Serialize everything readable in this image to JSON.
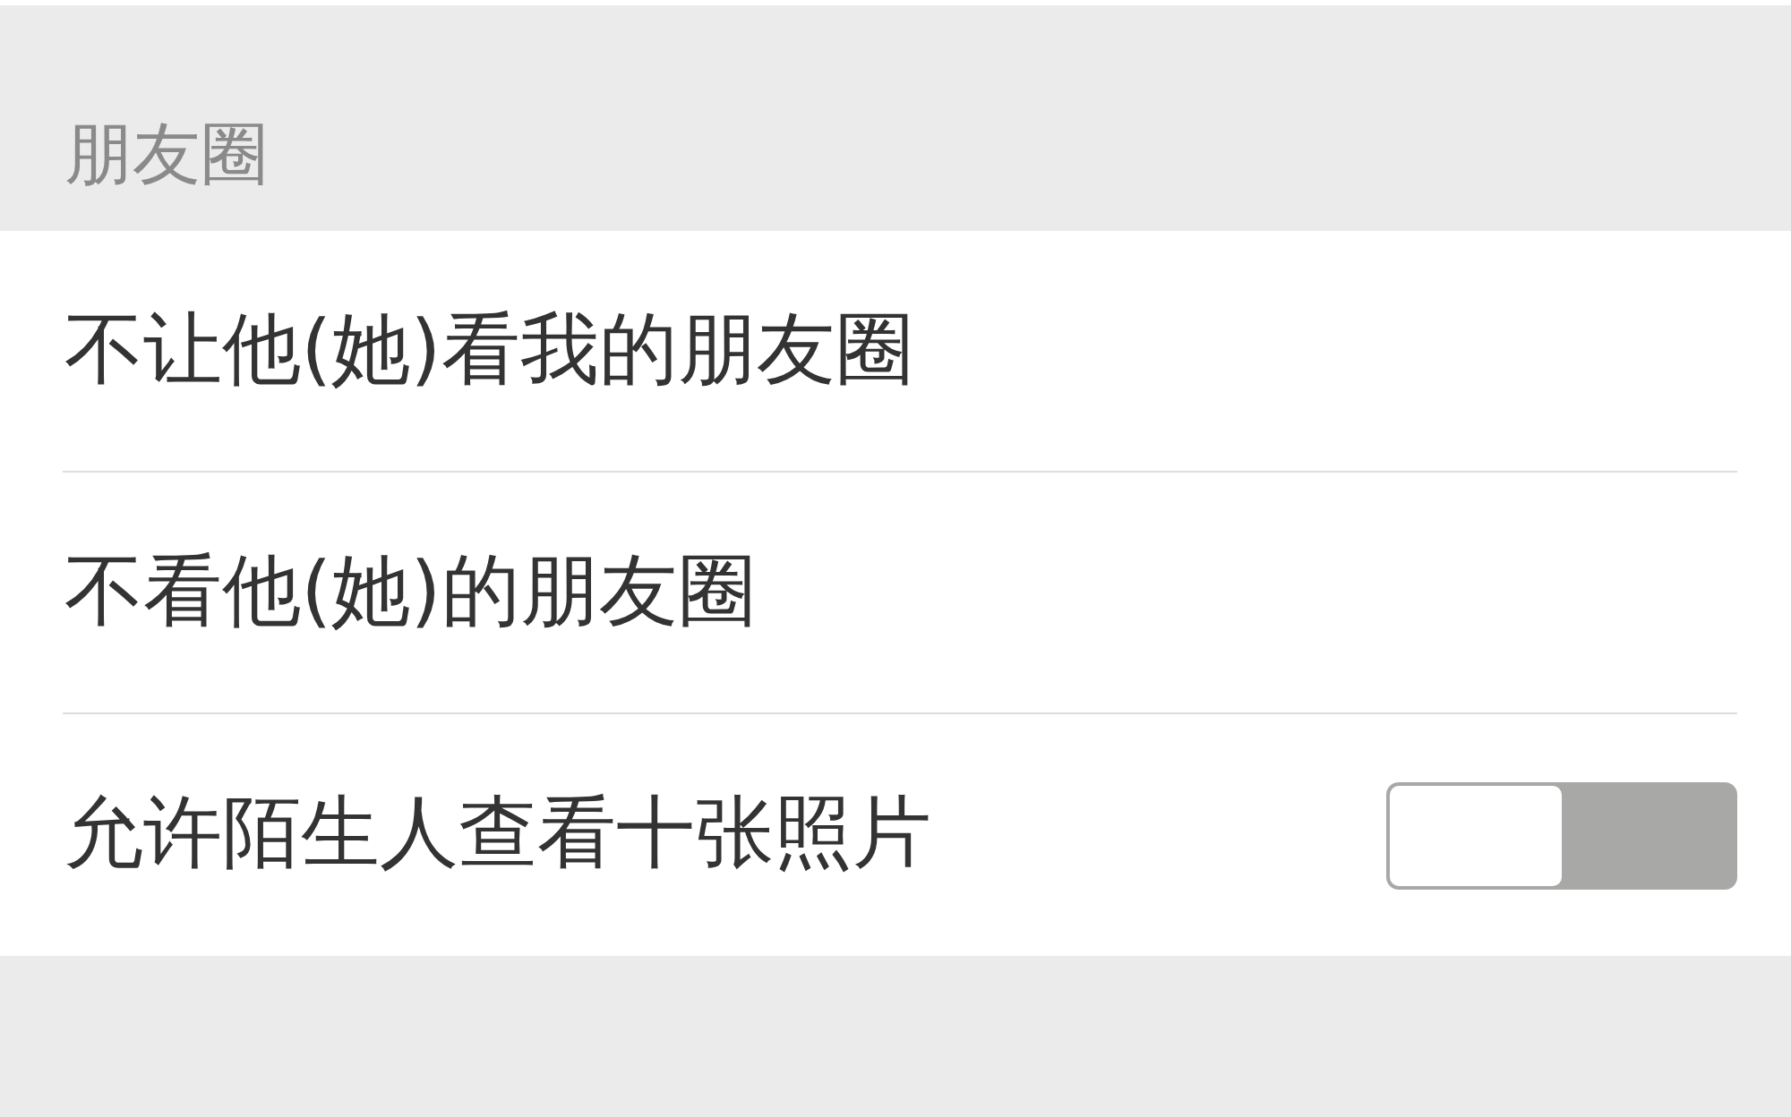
{
  "section": {
    "title": "朋友圈"
  },
  "items": [
    {
      "kind": "link",
      "label": "不让他(她)看我的朋友圈"
    },
    {
      "kind": "link",
      "label": "不看他(她)的朋友圈"
    },
    {
      "kind": "toggle",
      "label": "允许陌生人查看十张照片",
      "on": false
    }
  ]
}
